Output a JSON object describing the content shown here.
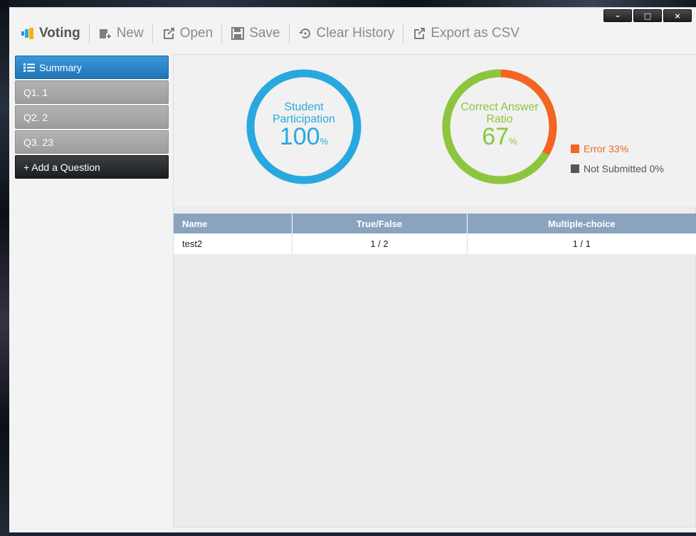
{
  "window_controls": {
    "minimize": "–",
    "maximize": "□",
    "close": "×"
  },
  "toolbar": {
    "brand": "Voting",
    "new": "New",
    "open": "Open",
    "save": "Save",
    "clear_history": "Clear History",
    "export_csv": "Export as CSV"
  },
  "sidebar": {
    "items": [
      {
        "label": "Summary",
        "active": true
      },
      {
        "label": "Q1. 1"
      },
      {
        "label": "Q2. 2"
      },
      {
        "label": "Q3. 23"
      }
    ],
    "add_question": "+ Add a Question"
  },
  "stats": {
    "participation": {
      "label_line1": "Student",
      "label_line2": "Participation",
      "value": "100",
      "unit": "%",
      "fraction": 1.0,
      "color": "#29a8e0"
    },
    "correct": {
      "label_line1": "Correct Answer",
      "label_line2": "Ratio",
      "value": "67",
      "unit": "%",
      "fraction": 0.67,
      "color": "#8cc63e",
      "error_color": "#f26522"
    },
    "legend": [
      {
        "label": "Error 33%",
        "color": "#f26522"
      },
      {
        "label": "Not Submitted 0%",
        "color": "#555555"
      }
    ]
  },
  "table": {
    "headers": [
      "Name",
      "True/False",
      "Multiple-choice"
    ],
    "rows": [
      [
        "test2",
        "1 / 2",
        "1 / 1"
      ]
    ]
  },
  "colors": {
    "accent": "#1f74b8",
    "table_header": "#8aa4bf"
  }
}
